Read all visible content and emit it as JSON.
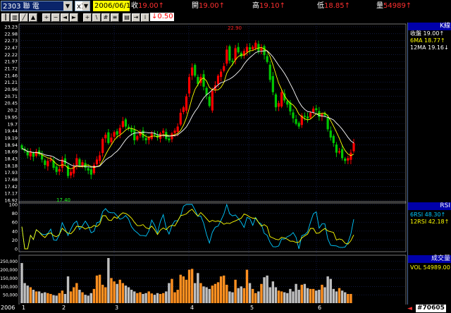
{
  "toolbar": {
    "stock_code": "2303 聯 電",
    "multiplier": "x1",
    "date": "2006/06/16",
    "quotes": [
      {
        "label": "收",
        "value": "19.00↑"
      },
      {
        "label": "開",
        "value": "19.00↑"
      },
      {
        "label": "高",
        "value": "19.10↑"
      },
      {
        "label": "低",
        "value": "18.85↑"
      },
      {
        "label": "量",
        "value": "54989↑"
      }
    ],
    "change": "0.50"
  },
  "legend": {
    "kline_title": "K線",
    "kline_rows": [
      "收盤 19.00↑",
      "6MA 18.77↑",
      "12MA 19.16↓"
    ],
    "rsi_title": "RSI",
    "rsi_rows": [
      "6RSI 48.30↑",
      "12RSI 42.18↑"
    ],
    "vol_title": "成交量",
    "vol_rows": [
      "VOL 54989.00↑"
    ]
  },
  "bottom": {
    "year": "2006",
    "months": [
      "1",
      "2",
      "3",
      "4",
      "5",
      "6"
    ],
    "code_badge": "#70605"
  },
  "colors": {
    "up": "#ff0000",
    "down": "#00c800",
    "ma6": "#ffff00",
    "ma12": "#ffffff",
    "rsi6": "#00c8ff",
    "rsi12": "#ffff00",
    "grid": "#1e2a6a"
  },
  "chart_data": {
    "type": "candlestick",
    "price_axis_ticks": [
      "23.23",
      "22.98",
      "22.73",
      "22.47",
      "22.22",
      "21.97",
      "21.72",
      "21.46",
      "21.21",
      "20.96",
      "20.71",
      "20.45",
      "20.2",
      "19.95",
      "19.7",
      "19.44",
      "19.19",
      "18.94",
      "18.69",
      "18.43",
      "18.18",
      "17.93",
      "17.68",
      "17.42",
      "17.17",
      "16.92"
    ],
    "ylim": [
      16.92,
      23.23
    ],
    "high_label": "22.90",
    "low_label": "17.40",
    "rsi_ticks": [
      "100",
      "80",
      "60",
      "40",
      "20",
      "0"
    ],
    "volume_ticks": [
      "250,000",
      "200,000",
      "150,000",
      "100,000",
      "50,000"
    ],
    "close": [
      18.8,
      18.72,
      18.55,
      18.66,
      18.5,
      18.7,
      18.6,
      18.4,
      18.2,
      18.35,
      18.4,
      18.1,
      17.95,
      18.05,
      18.4,
      18.25,
      17.8,
      17.95,
      18.15,
      18.45,
      18.2,
      18.3,
      18.1,
      18.0,
      17.85,
      18.2,
      18.4,
      18.55,
      19.15,
      19.3,
      19.0,
      19.2,
      19.4,
      19.3,
      19.55,
      19.8,
      19.6,
      19.55,
      19.4,
      19.1,
      19.25,
      19.4,
      19.2,
      19.1,
      19.2,
      19.35,
      19.3,
      19.2,
      19.35,
      19.45,
      19.15,
      19.1,
      19.35,
      19.45,
      19.6,
      20.1,
      20.3,
      20.7,
      21.4,
      21.75,
      21.45,
      21.15,
      21.4,
      21.05,
      20.75,
      20.35,
      20.9,
      21.1,
      21.45,
      21.6,
      21.8,
      22.4,
      22.0,
      21.95,
      22.45,
      22.3,
      22.15,
      22.35,
      22.5,
      22.4,
      22.5,
      22.65,
      22.35,
      22.45,
      22.2,
      21.95,
      21.3,
      20.85,
      20.3,
      20.45,
      20.85,
      20.55,
      20.4,
      20.15,
      19.9,
      19.7,
      19.6,
      20.0,
      19.95,
      19.9,
      20.1,
      20.25,
      20.2,
      19.95,
      20.05,
      20.0,
      19.5,
      19.2,
      19.0,
      18.65,
      18.7,
      18.45,
      18.35,
      18.45,
      18.65,
      19.0
    ],
    "volume": [
      240000,
      120000,
      105000,
      95000,
      80000,
      70000,
      70000,
      60000,
      65000,
      60000,
      55000,
      48000,
      45000,
      60000,
      75000,
      55000,
      160000,
      70000,
      95000,
      120000,
      80000,
      65000,
      50000,
      45000,
      60000,
      85000,
      165000,
      170000,
      110000,
      95000,
      270000,
      150000,
      130000,
      115000,
      140000,
      120000,
      105000,
      95000,
      80000,
      70000,
      60000,
      65000,
      55000,
      60000,
      70000,
      58000,
      50000,
      60000,
      55000,
      60000,
      70000,
      120000,
      145000,
      65000,
      80000,
      170000,
      160000,
      140000,
      200000,
      205000,
      120000,
      180000,
      120000,
      100000,
      95000,
      85000,
      105000,
      115000,
      125000,
      160000,
      165000,
      110000,
      70000,
      65000,
      140000,
      90000,
      100000,
      90000,
      200000,
      120000,
      85000,
      60000,
      70000,
      115000,
      155000,
      165000,
      95000,
      130000,
      95000,
      75000,
      70000,
      65000,
      60000,
      85000,
      70000,
      115000,
      80000,
      110000,
      115000,
      90000,
      85000,
      85000,
      75000,
      80000,
      110000,
      95000,
      160000,
      145000,
      85000,
      70000,
      90000,
      75000,
      65000,
      55000,
      55000
    ]
  }
}
